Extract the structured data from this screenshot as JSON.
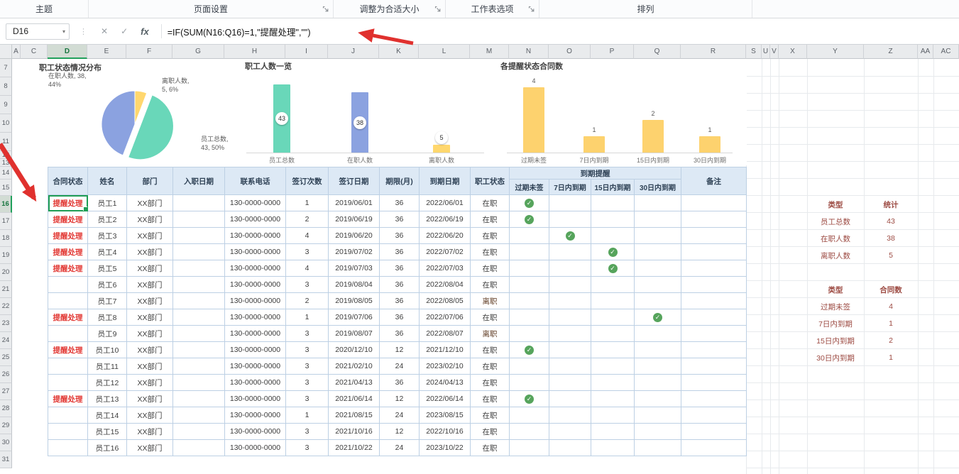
{
  "ribbon": {
    "groups": [
      {
        "label": "主题",
        "launcher": false
      },
      {
        "label": "页面设置",
        "launcher": true
      },
      {
        "label": "调整为合适大小",
        "launcher": true
      },
      {
        "label": "工作表选项",
        "launcher": true
      },
      {
        "label": "排列",
        "launcher": false
      }
    ]
  },
  "formula_bar": {
    "cell_ref": "D16",
    "formula": "=IF(SUM(N16:Q16)=1,\"提醒处理\",\"\")"
  },
  "icons": {
    "cancel": "✕",
    "enter": "✓",
    "insert_function": "fx",
    "name_box_dropdown": "▾",
    "formula_handle": "⋮",
    "check": "✓"
  },
  "grid": {
    "column_letters": [
      "A",
      "C",
      "D",
      "E",
      "F",
      "G",
      "H",
      "I",
      "J",
      "K",
      "L",
      "M",
      "N",
      "O",
      "P",
      "Q",
      "R",
      "S",
      "U",
      "V",
      "X",
      "Y",
      "Z",
      "AA",
      "AC"
    ],
    "row_numbers": [
      7,
      8,
      9,
      10,
      11,
      12,
      13,
      14,
      15,
      16,
      17,
      18,
      19,
      20,
      21,
      22,
      23,
      24,
      25,
      26,
      27,
      28,
      29,
      30,
      31
    ],
    "selected_column": "D",
    "selected_row": 16
  },
  "chart_data": [
    {
      "type": "pie",
      "title": "职工状态情况分布",
      "slices": [
        {
          "label": "离职人数",
          "value": 5,
          "percent": "6%",
          "color": "#ffd76e",
          "label_lines": [
            "离职人数,",
            "5, 6%"
          ],
          "exploded": false
        },
        {
          "label": "员工总数",
          "value": 43,
          "percent": "50%",
          "color": "#69d7b9",
          "label_lines": [
            "员工总数,",
            "43, 50%"
          ],
          "exploded": true
        },
        {
          "label": "在职人数",
          "value": 38,
          "percent": "44%",
          "color": "#8ba2e0",
          "label_lines": [
            "在职人数, 38,",
            "44%"
          ],
          "exploded": false
        }
      ]
    },
    {
      "type": "bar",
      "title": "职工人数一览",
      "categories": [
        "员工总数",
        "在职人数",
        "离职人数"
      ],
      "values": [
        43,
        38,
        5
      ],
      "colors": [
        "#69d7b9",
        "#8ba2e0",
        "#ffd76e"
      ],
      "value_badges": true
    },
    {
      "type": "bar",
      "title": "各提醒状态合同数",
      "categories": [
        "过期未签",
        "7日内到期",
        "15日内到期",
        "30日内到期"
      ],
      "values": [
        4,
        1,
        2,
        1
      ],
      "colors": [
        "#fdd26e",
        "#fdd26e",
        "#fdd26e",
        "#fdd26e"
      ],
      "value_badges": false
    }
  ],
  "table": {
    "header_row1": [
      "合同状态",
      "姓名",
      "部门",
      "入职日期",
      "联系电话",
      "签订次数",
      "签订日期",
      "期限(月)",
      "到期日期",
      "职工状态",
      "到期提醒",
      "备注"
    ],
    "reminder_subheaders": [
      "过期未签",
      "7日内到期",
      "15日内到期",
      "30日内到期"
    ],
    "rows": [
      {
        "status": "提醒处理",
        "name": "员工1",
        "dept": "XX部门",
        "hire_date": "",
        "phone": "130-0000-0000",
        "sign_count": "1",
        "sign_date": "2019/06/01",
        "term": "36",
        "expire_date": "2022/06/01",
        "emp_status": "在职",
        "reminder": 0,
        "note": ""
      },
      {
        "status": "提醒处理",
        "name": "员工2",
        "dept": "XX部门",
        "hire_date": "",
        "phone": "130-0000-0000",
        "sign_count": "2",
        "sign_date": "2019/06/19",
        "term": "36",
        "expire_date": "2022/06/19",
        "emp_status": "在职",
        "reminder": 0,
        "note": ""
      },
      {
        "status": "提醒处理",
        "name": "员工3",
        "dept": "XX部门",
        "hire_date": "",
        "phone": "130-0000-0000",
        "sign_count": "4",
        "sign_date": "2019/06/20",
        "term": "36",
        "expire_date": "2022/06/20",
        "emp_status": "在职",
        "reminder": 1,
        "note": ""
      },
      {
        "status": "提醒处理",
        "name": "员工4",
        "dept": "XX部门",
        "hire_date": "",
        "phone": "130-0000-0000",
        "sign_count": "3",
        "sign_date": "2019/07/02",
        "term": "36",
        "expire_date": "2022/07/02",
        "emp_status": "在职",
        "reminder": 2,
        "note": ""
      },
      {
        "status": "提醒处理",
        "name": "员工5",
        "dept": "XX部门",
        "hire_date": "",
        "phone": "130-0000-0000",
        "sign_count": "4",
        "sign_date": "2019/07/03",
        "term": "36",
        "expire_date": "2022/07/03",
        "emp_status": "在职",
        "reminder": 2,
        "note": ""
      },
      {
        "status": "",
        "name": "员工6",
        "dept": "XX部门",
        "hire_date": "",
        "phone": "130-0000-0000",
        "sign_count": "3",
        "sign_date": "2019/08/04",
        "term": "36",
        "expire_date": "2022/08/04",
        "emp_status": "在职",
        "reminder": -1,
        "note": ""
      },
      {
        "status": "",
        "name": "员工7",
        "dept": "XX部门",
        "hire_date": "",
        "phone": "130-0000-0000",
        "sign_count": "2",
        "sign_date": "2019/08/05",
        "term": "36",
        "expire_date": "2022/08/05",
        "emp_status": "离职",
        "reminder": -1,
        "note": ""
      },
      {
        "status": "提醒处理",
        "name": "员工8",
        "dept": "XX部门",
        "hire_date": "",
        "phone": "130-0000-0000",
        "sign_count": "1",
        "sign_date": "2019/07/06",
        "term": "36",
        "expire_date": "2022/07/06",
        "emp_status": "在职",
        "reminder": 3,
        "note": ""
      },
      {
        "status": "",
        "name": "员工9",
        "dept": "XX部门",
        "hire_date": "",
        "phone": "130-0000-0000",
        "sign_count": "3",
        "sign_date": "2019/08/07",
        "term": "36",
        "expire_date": "2022/08/07",
        "emp_status": "离职",
        "reminder": -1,
        "note": ""
      },
      {
        "status": "提醒处理",
        "name": "员工10",
        "dept": "XX部门",
        "hire_date": "",
        "phone": "130-0000-0000",
        "sign_count": "3",
        "sign_date": "2020/12/10",
        "term": "12",
        "expire_date": "2021/12/10",
        "emp_status": "在职",
        "reminder": 0,
        "note": ""
      },
      {
        "status": "",
        "name": "员工11",
        "dept": "XX部门",
        "hire_date": "",
        "phone": "130-0000-0000",
        "sign_count": "3",
        "sign_date": "2021/02/10",
        "term": "24",
        "expire_date": "2023/02/10",
        "emp_status": "在职",
        "reminder": -1,
        "note": ""
      },
      {
        "status": "",
        "name": "员工12",
        "dept": "XX部门",
        "hire_date": "",
        "phone": "130-0000-0000",
        "sign_count": "3",
        "sign_date": "2021/04/13",
        "term": "36",
        "expire_date": "2024/04/13",
        "emp_status": "在职",
        "reminder": -1,
        "note": ""
      },
      {
        "status": "提醒处理",
        "name": "员工13",
        "dept": "XX部门",
        "hire_date": "",
        "phone": "130-0000-0000",
        "sign_count": "3",
        "sign_date": "2021/06/14",
        "term": "12",
        "expire_date": "2022/06/14",
        "emp_status": "在职",
        "reminder": 0,
        "note": ""
      },
      {
        "status": "",
        "name": "员工14",
        "dept": "XX部门",
        "hire_date": "",
        "phone": "130-0000-0000",
        "sign_count": "1",
        "sign_date": "2021/08/15",
        "term": "24",
        "expire_date": "2023/08/15",
        "emp_status": "在职",
        "reminder": -1,
        "note": ""
      },
      {
        "status": "",
        "name": "员工15",
        "dept": "XX部门",
        "hire_date": "",
        "phone": "130-0000-0000",
        "sign_count": "3",
        "sign_date": "2021/10/16",
        "term": "12",
        "expire_date": "2022/10/16",
        "emp_status": "在职",
        "reminder": -1,
        "note": ""
      },
      {
        "status": "",
        "name": "员工16",
        "dept": "XX部门",
        "hire_date": "",
        "phone": "130-0000-0000",
        "sign_count": "3",
        "sign_date": "2021/10/22",
        "term": "24",
        "expire_date": "2023/10/22",
        "emp_status": "在职",
        "reminder": -1,
        "note": ""
      }
    ]
  },
  "summary_tables": [
    {
      "headers": [
        "类型",
        "统计"
      ],
      "rows": [
        [
          "员工总数",
          "43"
        ],
        [
          "在职人数",
          "38"
        ],
        [
          "离职人数",
          "5"
        ]
      ]
    },
    {
      "headers": [
        "类型",
        "合同数"
      ],
      "rows": [
        [
          "过期未签",
          "4"
        ],
        [
          "7日内到期",
          "1"
        ],
        [
          "15日内到期",
          "2"
        ],
        [
          "30日内到期",
          "1"
        ]
      ]
    }
  ]
}
